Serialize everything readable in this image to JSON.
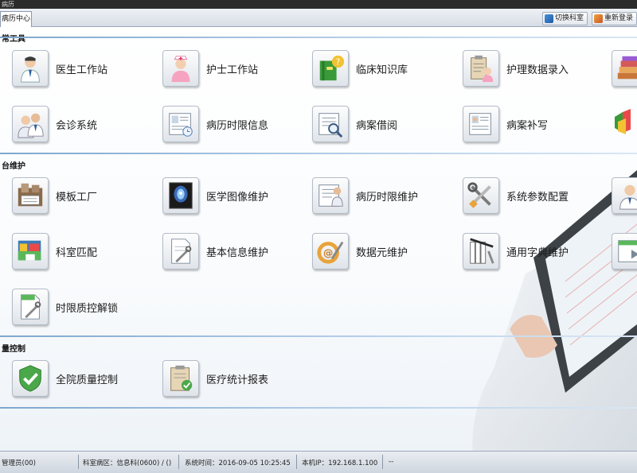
{
  "window": {
    "title": "病历"
  },
  "tabbar": {
    "active_tab": "病历中心",
    "buttons": [
      {
        "label": "切换科室",
        "icon": "switch-department-icon"
      },
      {
        "label": "重新登录",
        "icon": "relogin-icon"
      }
    ]
  },
  "sections": [
    {
      "title": "常工具",
      "items": [
        {
          "label": "医生工作站",
          "icon": "doctor-icon"
        },
        {
          "label": "护士工作站",
          "icon": "nurse-icon"
        },
        {
          "label": "临床知识库",
          "icon": "knowledge-base-icon"
        },
        {
          "label": "护理数据录入",
          "icon": "nursing-clipboard-icon"
        },
        {
          "label": "",
          "icon": "stacked-books-icon"
        },
        {
          "label": "会诊系统",
          "icon": "consultation-icon"
        },
        {
          "label": "病历时限信息",
          "icon": "record-deadline-icon"
        },
        {
          "label": "病案借阅",
          "icon": "record-borrow-icon"
        },
        {
          "label": "病案补写",
          "icon": "record-supplement-icon"
        },
        {
          "label": "",
          "icon": "shield-chart-icon"
        }
      ]
    },
    {
      "title": "台维护",
      "items": [
        {
          "label": "模板工厂",
          "icon": "template-factory-icon"
        },
        {
          "label": "医学图像维护",
          "icon": "medical-image-icon"
        },
        {
          "label": "病历时限维护",
          "icon": "deadline-maintenance-icon"
        },
        {
          "label": "系统参数配置",
          "icon": "tools-icon"
        },
        {
          "label": "",
          "icon": "user-admin-icon"
        },
        {
          "label": "科室匹配",
          "icon": "department-match-icon"
        },
        {
          "label": "基本信息维护",
          "icon": "basic-info-icon"
        },
        {
          "label": "数据元维护",
          "icon": "data-element-icon"
        },
        {
          "label": "通用字典维护",
          "icon": "dictionary-icon"
        },
        {
          "label": "",
          "icon": "form-next-icon"
        },
        {
          "label": "时限质控解锁",
          "icon": "deadline-unlock-icon"
        }
      ]
    },
    {
      "title": "量控制",
      "items": [
        {
          "label": "全院质量控制",
          "icon": "quality-shield-icon"
        },
        {
          "label": "医疗统计报表",
          "icon": "statistics-report-icon"
        }
      ]
    }
  ],
  "statusbar": {
    "user": "管理员(00)",
    "department": "科室病区：信息科(0600) / ()",
    "system_time": "系统时间：2016-09-05 10:25:45",
    "local_ip": "本机IP：192.168.1.100",
    "extra": "--"
  },
  "colors": {
    "accent_line": "#7fa7cf",
    "tabbar_bg": "#d7dde6",
    "statusbar_bg": "#cfd6df"
  }
}
